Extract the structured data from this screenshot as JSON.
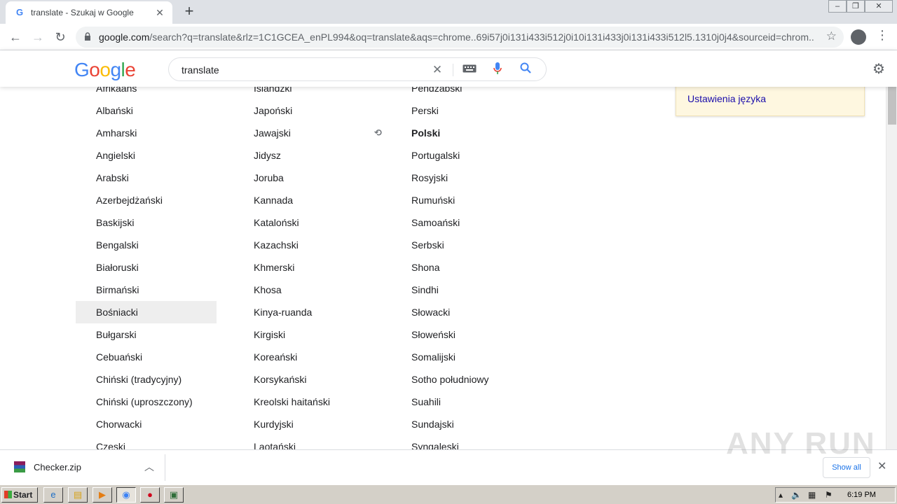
{
  "browser": {
    "tab_title": "translate - Szukaj w Google",
    "tab_favicon": "G",
    "url_domain": "google.com",
    "url_path": "/search?q=translate&rlz=1C1GCEA_enPL994&oq=translate&aqs=chrome..69i57j0i131i433i512j0i10i131i433j0i131i433i512l5.1310j0j4&sourceid=chrom..."
  },
  "google": {
    "logo_letters": [
      "G",
      "o",
      "o",
      "g",
      "l",
      "e"
    ],
    "logo_colors": [
      "#4285f4",
      "#ea4335",
      "#fbbc05",
      "#4285f4",
      "#34a853",
      "#ea4335"
    ],
    "search_value": "translate"
  },
  "languages": {
    "col1": [
      "Afrikaans",
      "Albański",
      "Amharski",
      "Angielski",
      "Arabski",
      "Azerbejdżański",
      "Baskijski",
      "Bengalski",
      "Białoruski",
      "Birmański",
      "Bośniacki",
      "Bułgarski",
      "Cebuański",
      "Chiński (tradycyjny)",
      "Chiński (uproszczony)",
      "Chorwacki",
      "Czeski"
    ],
    "col2": [
      "Islandzki",
      "Japoński",
      "Jawajski",
      "Jidysz",
      "Joruba",
      "Kannada",
      "Kataloński",
      "Kazachski",
      "Khmerski",
      "Khosa",
      "Kinya-ruanda",
      "Kirgiski",
      "Koreański",
      "Korsykański",
      "Kreolski haitański",
      "Kurdyjski",
      "Laotański"
    ],
    "col3": [
      "Pendżabski",
      "Perski",
      "Polski",
      "Portugalski",
      "Rosyjski",
      "Rumuński",
      "Samoański",
      "Serbski",
      "Shona",
      "Sindhi",
      "Słowacki",
      "Słoweński",
      "Somalijski",
      "Sotho południowy",
      "Suahili",
      "Sundajski",
      "Syngaleski"
    ],
    "highlighted": "Bośniacki",
    "selected": "Polski"
  },
  "notice": {
    "link": "Ustawienia języka"
  },
  "download": {
    "file": "Checker.zip",
    "show_all": "Show all",
    "watermark": "ANY RUN"
  },
  "taskbar": {
    "start": "Start",
    "clock": "6:19 PM"
  }
}
